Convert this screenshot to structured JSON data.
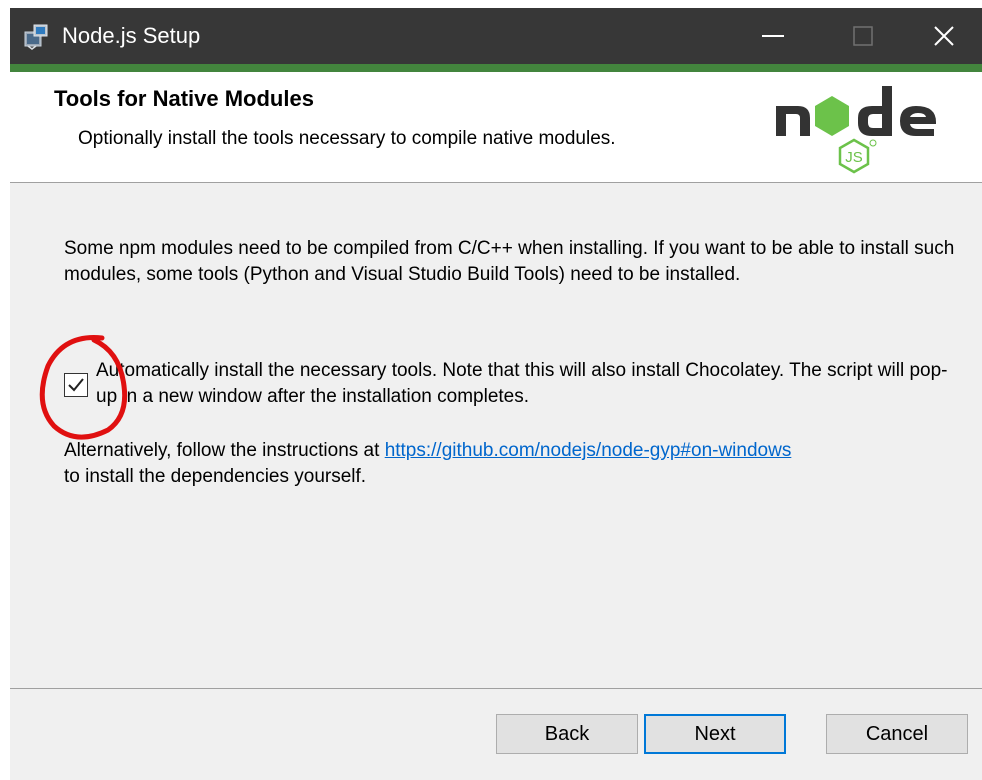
{
  "window": {
    "title": "Node.js Setup",
    "minimize_glyph": "—",
    "close_glyph": "✕"
  },
  "header": {
    "title": "Tools for Native Modules",
    "subtitle": "Optionally install the tools necessary to compile native modules."
  },
  "content": {
    "description": "Some npm modules need to be compiled from C/C++ when installing. If you want to be able to install such modules, some tools (Python and Visual Studio Build Tools) need to be installed.",
    "checkbox_checked": true,
    "checkbox_label": "Automatically install the necessary tools. Note that this will also install Chocolatey. The script will pop-up in a new window after the installation completes.",
    "alt_prefix": "Alternatively, follow the instructions at ",
    "alt_link": "https://github.com/nodejs/node-gyp#on-windows",
    "alt_suffix": "to install the dependencies yourself."
  },
  "buttons": {
    "back": "Back",
    "next": "Next",
    "cancel": "Cancel"
  },
  "icons": {
    "app": "installer-icon",
    "logo": "nodejs-logo",
    "checkmark": "checkmark-icon"
  },
  "colors": {
    "titlebar": "#373737",
    "accent": "#43853d",
    "link": "#0066cc",
    "focus_border": "#0078d7",
    "annotation": "#e01010"
  }
}
